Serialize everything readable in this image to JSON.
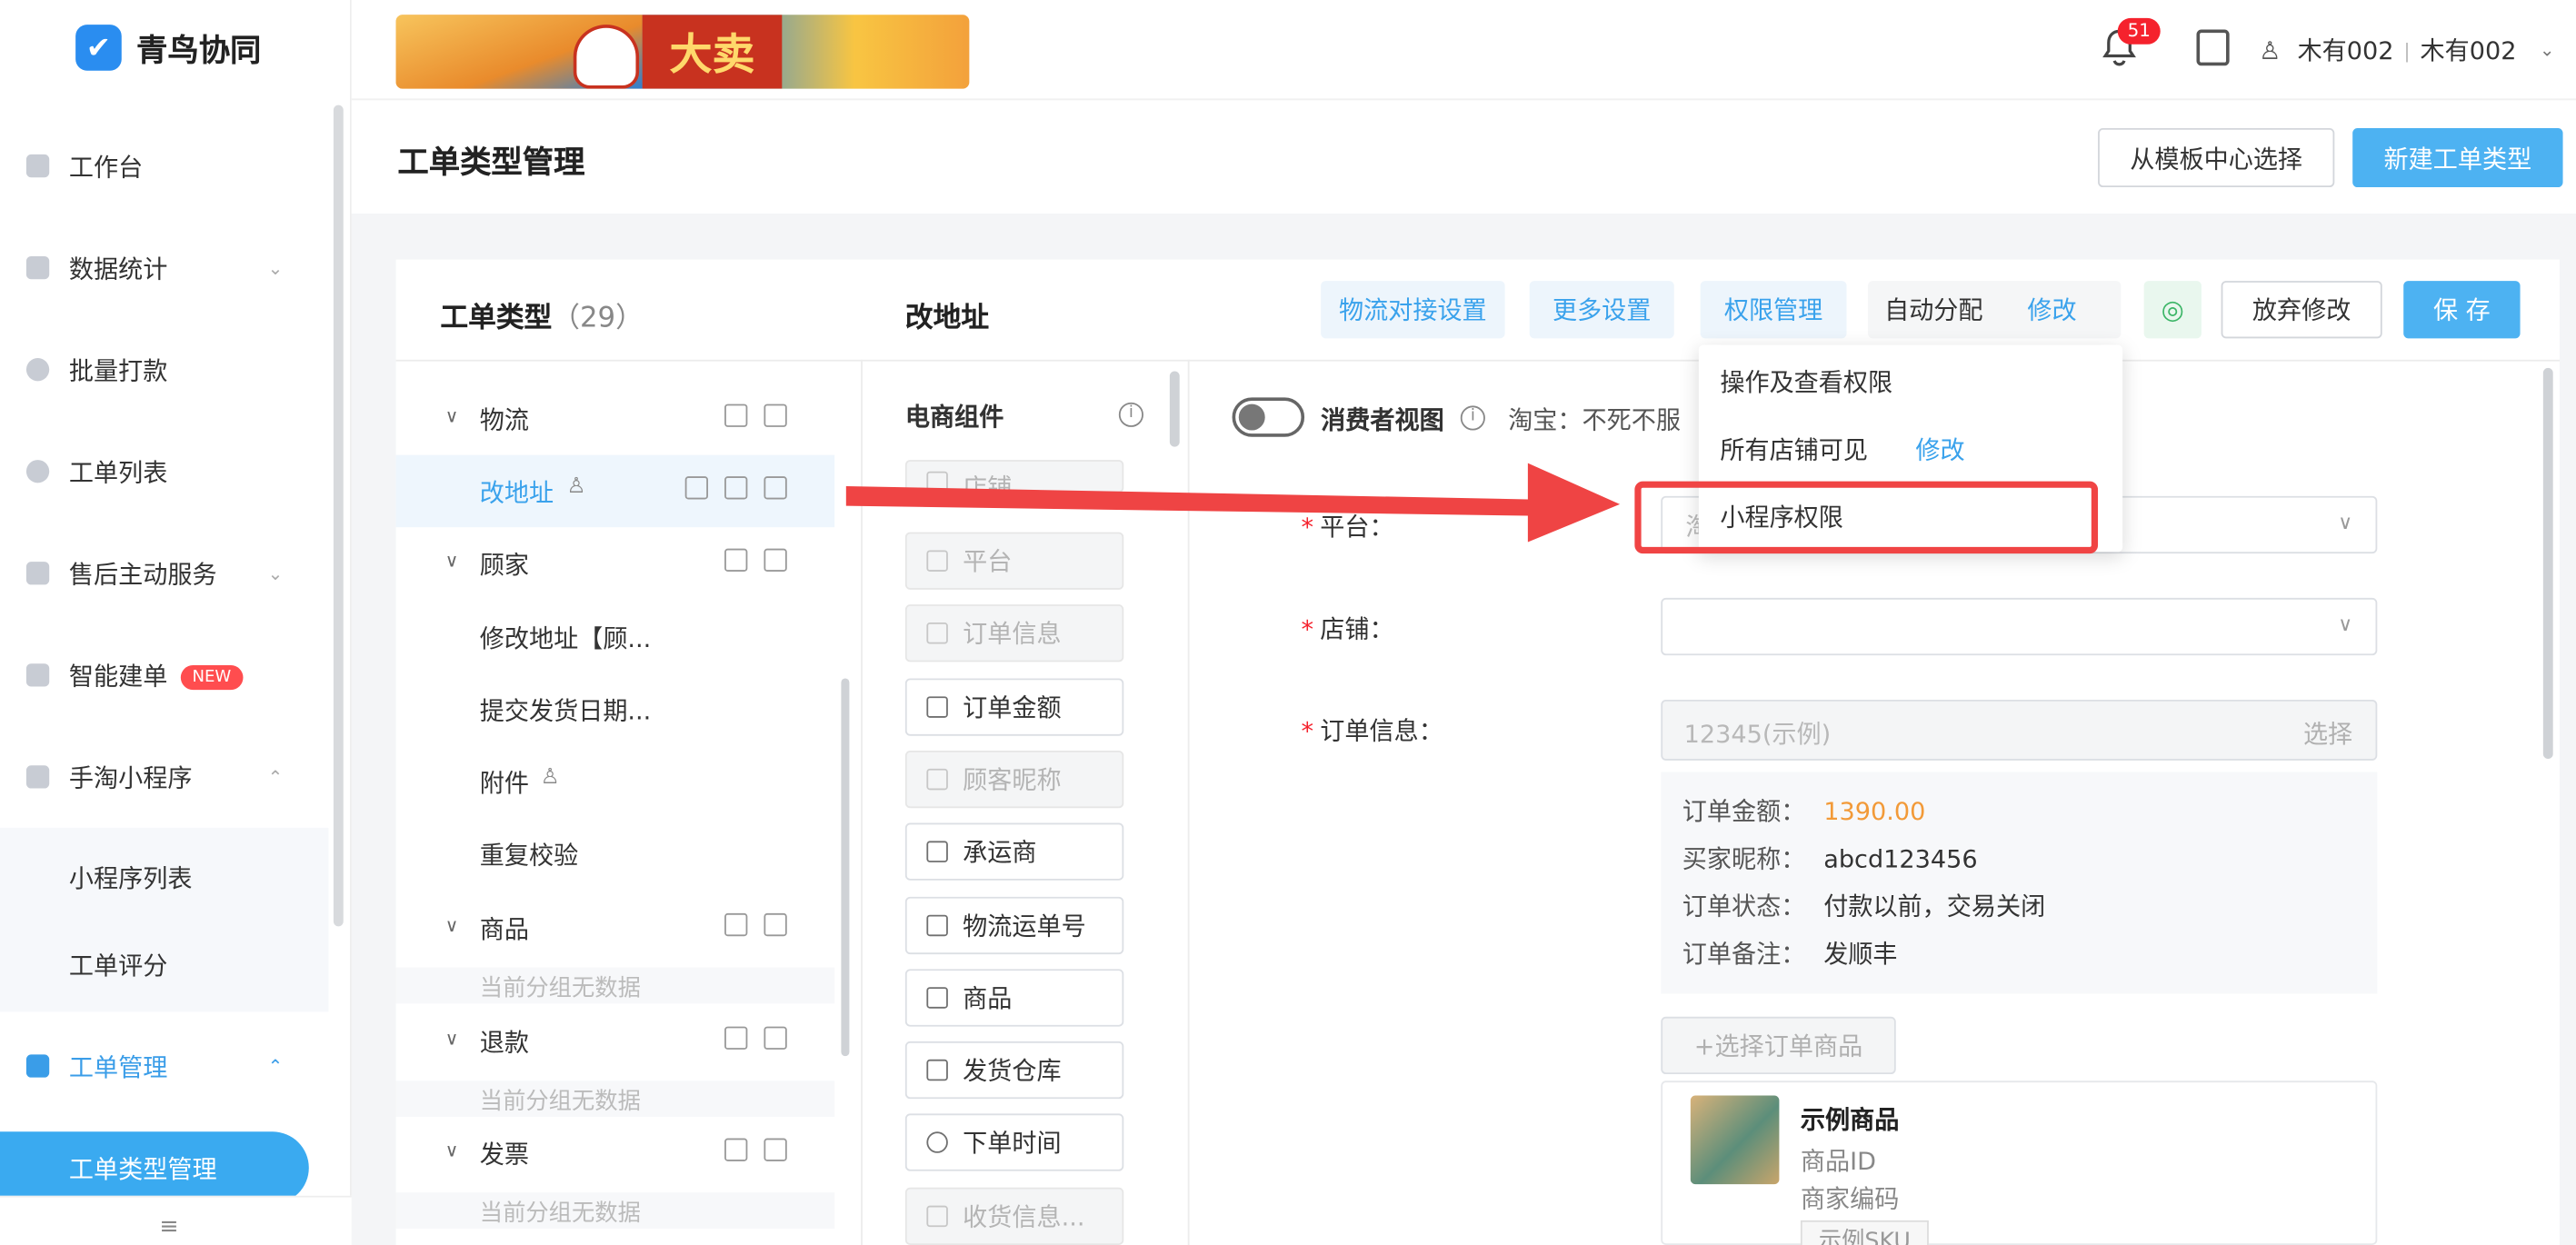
{
  "app": {
    "name": "青鸟协同"
  },
  "sidebar": {
    "items": [
      {
        "label": "工作台",
        "icon": "monitor-icon"
      },
      {
        "label": "数据统计",
        "icon": "bar-chart-icon",
        "expandable": true
      },
      {
        "label": "批量打款",
        "icon": "coin-icon"
      },
      {
        "label": "工单列表",
        "icon": "search-icon"
      },
      {
        "label": "售后主动服务",
        "icon": "chat-icon",
        "expandable": true
      },
      {
        "label": "智能建单",
        "icon": "doc-icon",
        "badge": "NEW"
      },
      {
        "label": "手淘小程序",
        "icon": "clipboard-icon",
        "expanded": true
      },
      {
        "label": "小程序列表"
      },
      {
        "label": "工单评分"
      },
      {
        "label": "工单管理",
        "icon": "ticket-icon",
        "expanded": true
      },
      {
        "label": "工单类型管理"
      }
    ],
    "collapse_icon": "≡"
  },
  "topbar": {
    "banner_text": "大卖",
    "notification_count": "51",
    "user": "木有002",
    "account": "木有002"
  },
  "page": {
    "title": "工单类型管理",
    "template_button": "从模板中心选择",
    "new_button": "新建工单类型"
  },
  "types_panel": {
    "heading": "工单类型",
    "count": "（29）",
    "rows": [
      {
        "label": "物流",
        "group": true
      },
      {
        "label": "改地址",
        "selected": true
      },
      {
        "label": "顾家",
        "group": true
      },
      {
        "label": "修改地址【顾..."
      },
      {
        "label": "提交发货日期..."
      },
      {
        "label": "附件"
      },
      {
        "label": "重复校验"
      },
      {
        "label": "商品",
        "group": true
      },
      {
        "label": "退款",
        "group": true
      },
      {
        "label": "发票",
        "group": true
      }
    ],
    "empty_text": "当前分组无数据"
  },
  "editor": {
    "name": "改地址",
    "tabs": {
      "logistics": "物流对接设置",
      "more": "更多设置",
      "permission": "权限管理",
      "auto_assign": "自动分配",
      "modify": "修改"
    },
    "discard_button": "放弃修改",
    "save_button": "保 存"
  },
  "components": {
    "heading": "电商组件",
    "items": [
      {
        "label": "店铺",
        "disabled": true
      },
      {
        "label": "平台",
        "disabled": true
      },
      {
        "label": "订单信息",
        "disabled": true
      },
      {
        "label": "订单金额"
      },
      {
        "label": "顾客昵称",
        "disabled": true
      },
      {
        "label": "承运商"
      },
      {
        "label": "物流运单号"
      },
      {
        "label": "商品"
      },
      {
        "label": "发货仓库"
      },
      {
        "label": "下单时间"
      },
      {
        "label": "收货信息...",
        "disabled": true
      }
    ]
  },
  "form": {
    "consumer_view": "消费者视图",
    "hint": "淘宝：不死不服",
    "platform_label": "平台：",
    "platform_value": "淘",
    "shop_label": "店铺：",
    "order_label": "订单信息：",
    "order_placeholder": "12345(示例)",
    "order_select": "选择",
    "info": [
      {
        "k": "订单金额：",
        "v": "1390.00"
      },
      {
        "k": "买家昵称：",
        "v": "abcd123456"
      },
      {
        "k": "订单状态：",
        "v": "付款以前，交易关闭"
      },
      {
        "k": "订单备注：",
        "v": "发顺丰"
      }
    ],
    "select_goods": "+选择订单商品",
    "product": {
      "name": "示例商品",
      "id": "商品ID",
      "code": "商家编码",
      "sku": "示例SKU"
    }
  },
  "permission_menu": {
    "items": [
      "操作及查看权限",
      "所有店铺可见",
      "小程序权限"
    ],
    "modify": "修改"
  },
  "colors": {
    "accent": "#4db2f2",
    "danger": "#f04444",
    "price": "#f29a38"
  }
}
